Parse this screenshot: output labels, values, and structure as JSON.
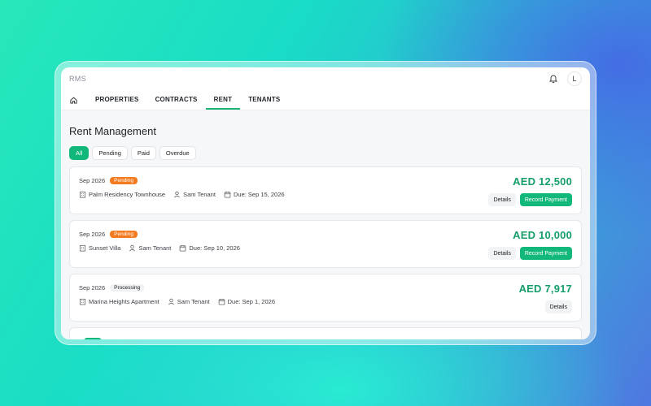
{
  "app": {
    "title": "RMS",
    "user_initial": "L"
  },
  "nav": {
    "home_icon": "home-icon",
    "tabs": [
      {
        "label": "PROPERTIES",
        "active": false
      },
      {
        "label": "CONTRACTS",
        "active": false
      },
      {
        "label": "RENT",
        "active": true
      },
      {
        "label": "TENANTS",
        "active": false
      }
    ]
  },
  "page": {
    "title": "Rent Management"
  },
  "filters": [
    {
      "label": "All",
      "active": true
    },
    {
      "label": "Pending",
      "active": false
    },
    {
      "label": "Paid",
      "active": false
    },
    {
      "label": "Overdue",
      "active": false
    }
  ],
  "payments": [
    {
      "period": "Sep 2026",
      "status": "Pending",
      "property": "Palm Residency Townhouse",
      "tenant": "Sam Tenant",
      "due": "Due: Sep 15, 2026",
      "amount": "AED 12,500",
      "details_label": "Details",
      "record_label": "Record Payment"
    },
    {
      "period": "Sep 2026",
      "status": "Pending",
      "property": "Sunset Villa",
      "tenant": "Sam Tenant",
      "due": "Due: Sep 10, 2026",
      "amount": "AED 10,000",
      "details_label": "Details",
      "record_label": "Record Payment"
    },
    {
      "period": "Sep 2026",
      "status": "Processing",
      "property": "Marina Heights Apartment",
      "tenant": "Sam Tenant",
      "due": "Due: Sep 1, 2026",
      "amount": "AED 7,917",
      "details_label": "Details",
      "record_label": ""
    }
  ],
  "colors": {
    "accent": "#12b77a",
    "amount": "#169e6a",
    "pending": "#f47a1f"
  }
}
